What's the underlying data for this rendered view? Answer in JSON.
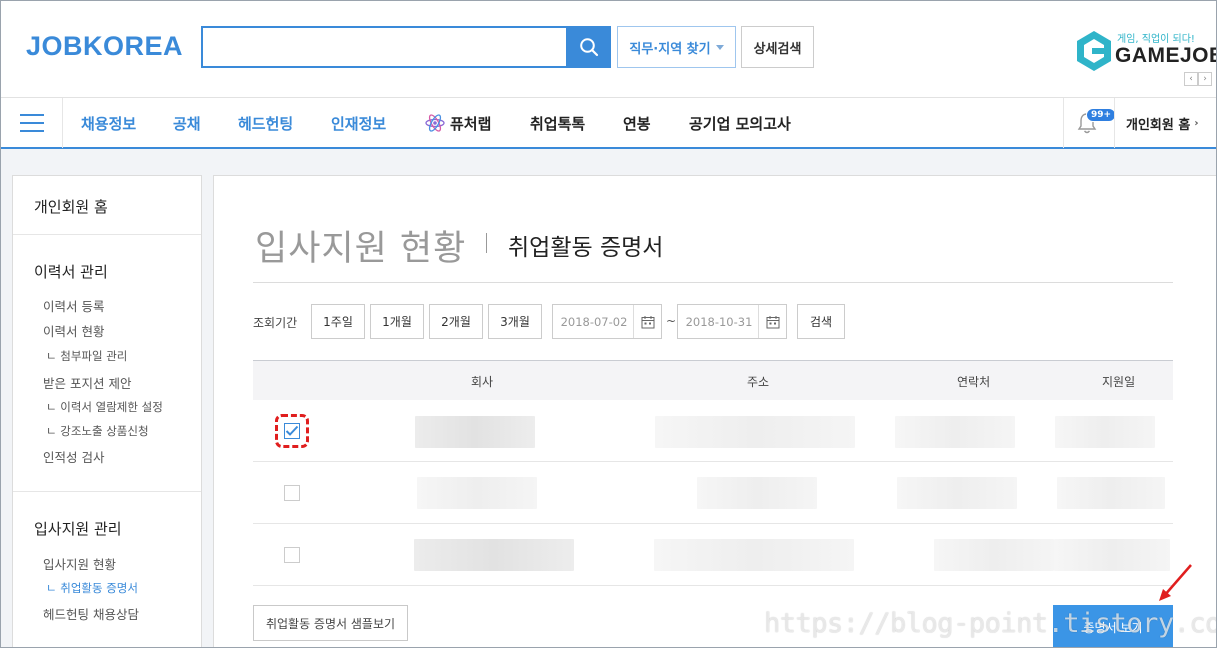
{
  "header": {
    "logo": "JOBKOREA",
    "search_placeholder": "",
    "job_region_label": "직무·지역 찾기",
    "detail_search_label": "상세검색",
    "gamejob": {
      "tagline": "게임, 직업이 되다!",
      "name": "GAMEJOB"
    },
    "arrows": [
      "‹",
      "›"
    ]
  },
  "nav": {
    "items": [
      "채용정보",
      "공채",
      "헤드헌팅",
      "인재정보",
      "퓨처랩",
      "취업톡톡",
      "연봉",
      "공기업 모의고사"
    ],
    "badge": "99+",
    "member_home": "개인회원 홈"
  },
  "sidebar": {
    "home": "개인회원 홈",
    "resume": {
      "title": "이력서 관리",
      "links": [
        "이력서 등록",
        "이력서 현황",
        "첨부파일 관리",
        "받은 포지션 제안",
        "이력서 열람제한 설정",
        "강조노출 상품신청",
        "인적성 검사"
      ]
    },
    "apply": {
      "title": "입사지원 관리",
      "links": [
        "입사지원 현황",
        "취업활동 증명서",
        "헤드헌팅 채용상담"
      ]
    }
  },
  "main": {
    "title": "입사지원 현황",
    "subtitle": "취업활동 증명서",
    "period_label": "조회기간",
    "period_buttons": [
      "1주일",
      "1개월",
      "2개월",
      "3개월"
    ],
    "date_from": "2018-07-02",
    "date_to": "2018-10-31",
    "tilde": "~",
    "search_label": "검색",
    "columns": [
      "회사",
      "주소",
      "연락처",
      "지원일"
    ],
    "rows": [
      {
        "checked": true
      },
      {
        "checked": false
      },
      {
        "checked": false
      }
    ],
    "sample_label": "취업활동 증명서 샘플보기",
    "view_label": "증명서 보기"
  },
  "watermark": "https://blog-point.tistory.com/",
  "colors": {
    "brand": "#3a8ad9",
    "button": "#3b95e6",
    "annotation": "#e01e1e"
  }
}
